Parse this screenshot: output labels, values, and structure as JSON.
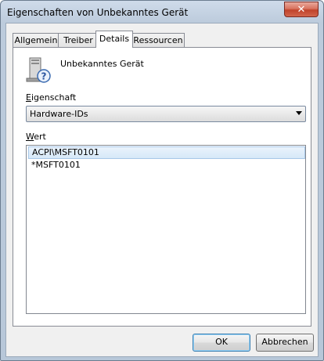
{
  "window": {
    "title": "Eigenschaften von Unbekanntes Gerät"
  },
  "icons": {
    "close": "close-icon",
    "device": "unknown-device-icon"
  },
  "tabs": [
    {
      "label": "Allgemein",
      "active": false
    },
    {
      "label": "Treiber",
      "active": false
    },
    {
      "label": "Details",
      "active": true
    },
    {
      "label": "Ressourcen",
      "active": false
    }
  ],
  "device": {
    "name": "Unbekanntes Gerät"
  },
  "property": {
    "label_first": "E",
    "label_rest": "igenschaft",
    "selected": "Hardware-IDs"
  },
  "value": {
    "label_first": "W",
    "label_rest": "ert",
    "items": [
      "ACPI\\MSFT0101",
      "*MSFT0101"
    ]
  },
  "buttons": {
    "ok": "OK",
    "cancel": "Abbrechen"
  },
  "colors": {
    "close_button": "#c0432b",
    "selection": "#d6e8f8",
    "frame": "#bccbdc"
  }
}
